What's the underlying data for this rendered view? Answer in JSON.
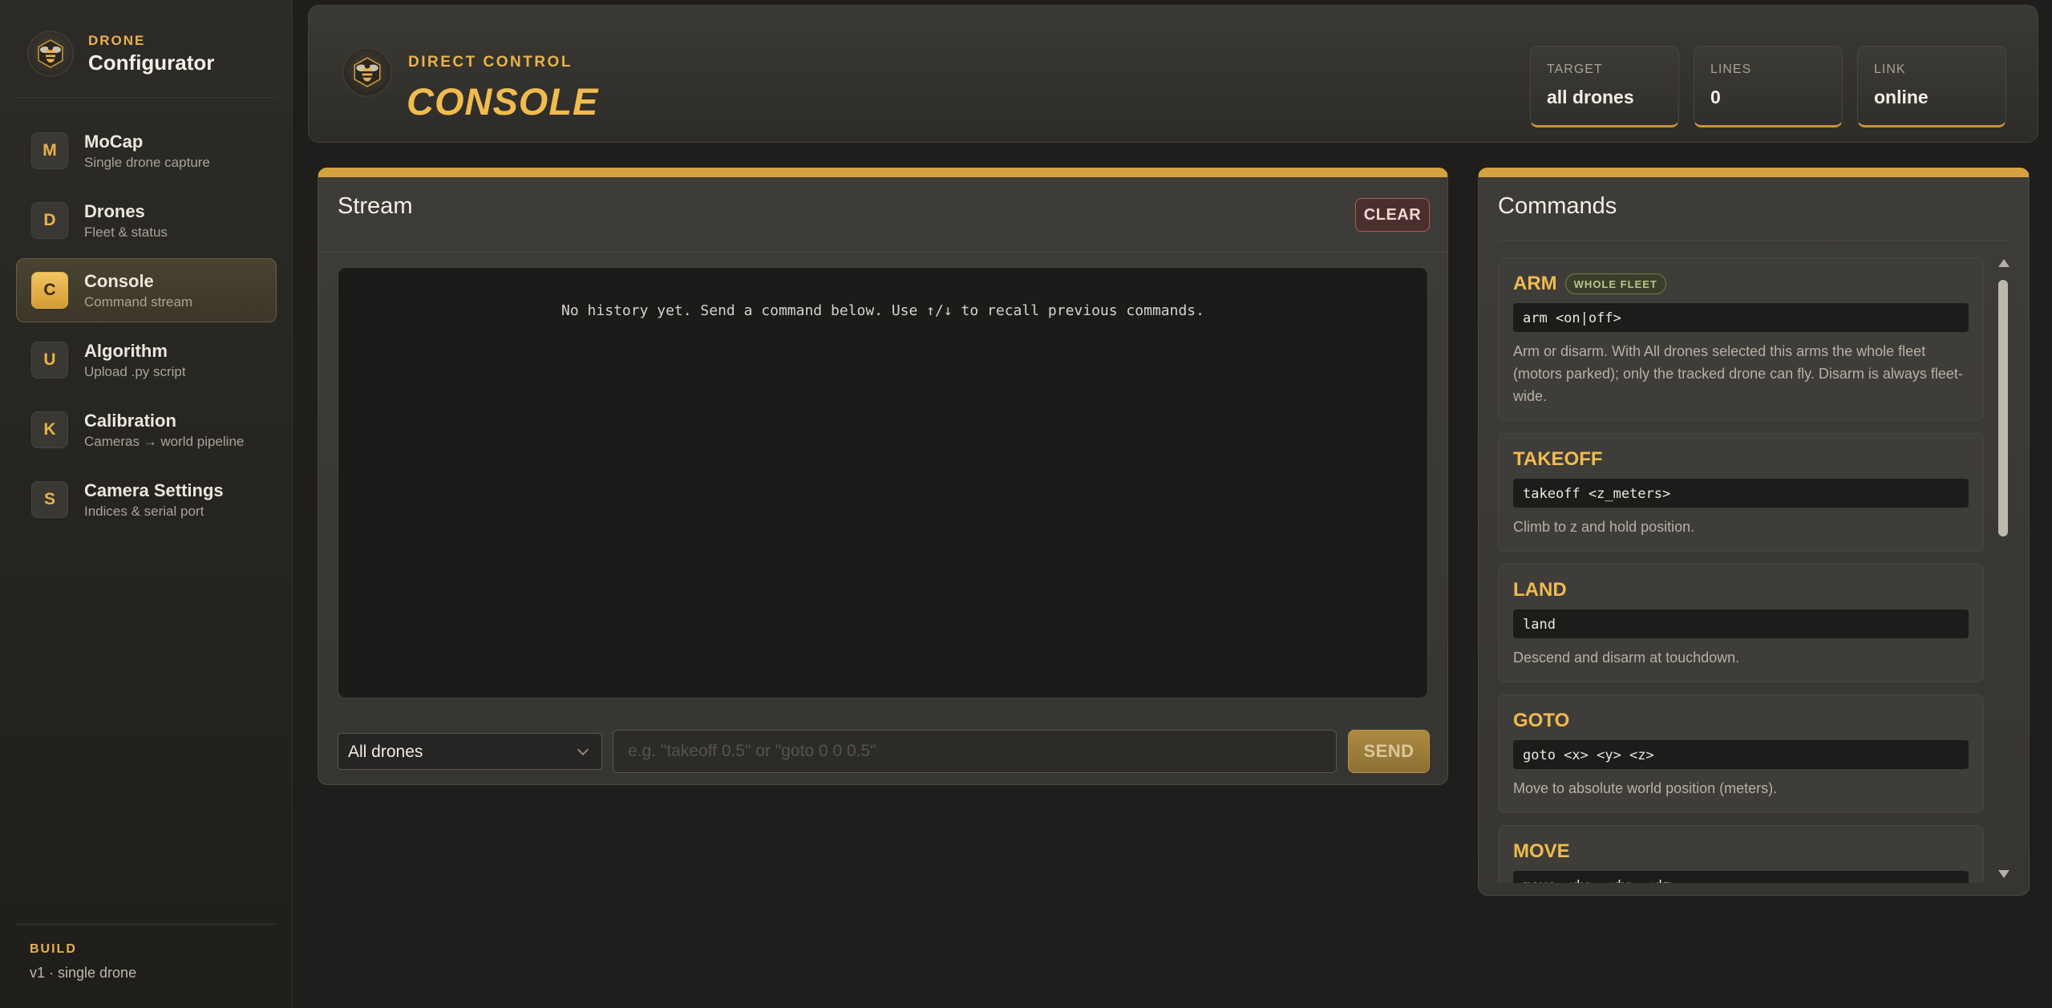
{
  "brand": {
    "kicker": "DRONE",
    "title": "Configurator"
  },
  "nav": [
    {
      "badge": "M",
      "title": "MoCap",
      "subtitle": "Single drone capture",
      "active": false
    },
    {
      "badge": "D",
      "title": "Drones",
      "subtitle": "Fleet & status",
      "active": false
    },
    {
      "badge": "C",
      "title": "Console",
      "subtitle": "Command stream",
      "active": true
    },
    {
      "badge": "U",
      "title": "Algorithm",
      "subtitle": "Upload .py script",
      "active": false
    },
    {
      "badge": "K",
      "title": "Calibration",
      "subtitle": "Cameras → world pipeline",
      "active": false
    },
    {
      "badge": "S",
      "title": "Camera Settings",
      "subtitle": "Indices & serial port",
      "active": false
    }
  ],
  "build": {
    "label": "BUILD",
    "value": "v1 · single drone"
  },
  "header": {
    "kicker": "DIRECT CONTROL",
    "title": "CONSOLE",
    "stats": [
      {
        "label": "TARGET",
        "value": "all drones"
      },
      {
        "label": "LINES",
        "value": "0"
      },
      {
        "label": "LINK",
        "value": "online"
      }
    ]
  },
  "stream": {
    "title": "Stream",
    "clear_label": "CLEAR",
    "empty_message": "No history yet. Send a command below. Use ↑/↓ to recall previous commands.",
    "target_selected": "All drones",
    "input_placeholder": "e.g. \"takeoff 0.5\" or \"goto 0 0 0.5\"",
    "input_value": "",
    "send_label": "SEND"
  },
  "commands": {
    "title": "Commands",
    "items": [
      {
        "name": "ARM",
        "badge": "WHOLE FLEET",
        "syntax": "arm <on|off>",
        "description": "Arm or disarm. With All drones selected this arms the whole fleet (motors parked); only the tracked drone can fly. Disarm is always fleet-wide."
      },
      {
        "name": "TAKEOFF",
        "badge": "",
        "syntax": "takeoff <z_meters>",
        "description": "Climb to z and hold position."
      },
      {
        "name": "LAND",
        "badge": "",
        "syntax": "land",
        "description": "Descend and disarm at touchdown."
      },
      {
        "name": "GOTO",
        "badge": "",
        "syntax": "goto <x> <y> <z>",
        "description": "Move to absolute world position (meters)."
      },
      {
        "name": "MOVE",
        "badge": "",
        "syntax": "move <dx> <dy> <dz>",
        "description": ""
      }
    ]
  },
  "colors": {
    "accent": "#e9b24a",
    "background": "#1f1e1c",
    "panel": "#3e3c38"
  },
  "icons": {
    "brand": "bee-icon",
    "header": "bee-icon"
  }
}
